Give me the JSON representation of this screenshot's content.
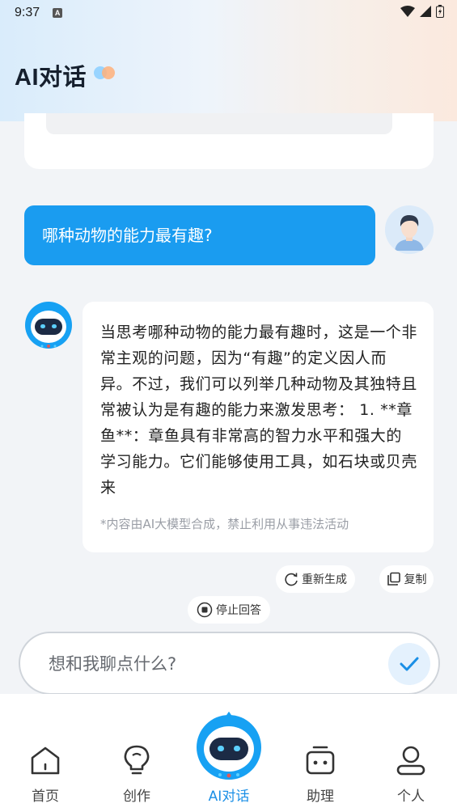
{
  "status_bar": {
    "time": "9:37",
    "notification_badge": "A"
  },
  "header": {
    "title": "AI对话"
  },
  "conversation": {
    "user_message": "哪种动物的能力最有趣?",
    "bot_reply": "当思考哪种动物的能力最有趣时，这是一个非常主观的问题，因为“有趣”的定义因人而异。不过，我们可以列举几种动物及其独特且常被认为是有趣的能力来激发思考： 1. **章鱼**：章鱼具有非常高的智力水平和强大的学习能力。它们能够使用工具，如石块或贝壳来",
    "disclaimer": "*内容由AI大模型合成，禁止利用从事违法活动"
  },
  "actions": {
    "regenerate": "重新生成",
    "copy": "复制",
    "stop": "停止回答"
  },
  "input": {
    "placeholder": "想和我聊点什么?"
  },
  "bottom_nav": [
    {
      "label": "首页",
      "icon": "home-icon"
    },
    {
      "label": "创作",
      "icon": "lightbulb-icon"
    },
    {
      "label": "AI对话",
      "icon": "robot-icon",
      "active": true
    },
    {
      "label": "助理",
      "icon": "assistant-icon"
    },
    {
      "label": "个人",
      "icon": "person-icon"
    }
  ],
  "colors": {
    "accent": "#1a9cf0",
    "active_tab": "#1a8fe6",
    "background": "#f2f4f7"
  }
}
